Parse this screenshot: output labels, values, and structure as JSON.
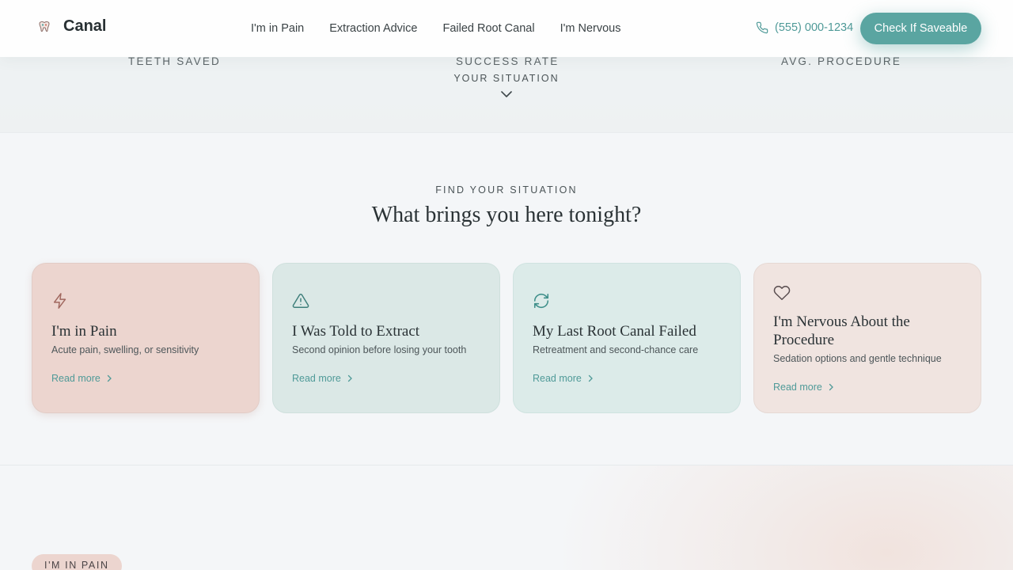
{
  "brand": {
    "name": "Canal"
  },
  "nav": {
    "links": [
      "I'm in Pain",
      "Extraction Advice",
      "Failed Root Canal",
      "I'm Nervous"
    ],
    "phone": "(555) 000-1234",
    "cta": "Check If Saveable"
  },
  "stats": {
    "labels": [
      "TEETH SAVED",
      "SUCCESS RATE",
      "AVG. PROCEDURE"
    ]
  },
  "scroll_hint": "YOUR SITUATION",
  "situations": {
    "eyebrow": "FIND YOUR SITUATION",
    "title": "What brings you here tonight?",
    "cards": [
      {
        "icon": "lightning-icon",
        "title": "I'm in Pain",
        "desc": "Acute pain, swelling, or sensitivity",
        "link": "Read more",
        "color": "#ecd5cf"
      },
      {
        "icon": "warning-icon",
        "title": "I Was Told to Extract",
        "desc": "Second opinion before losing your tooth",
        "link": "Read more",
        "color": "#dbe8e6"
      },
      {
        "icon": "refresh-icon",
        "title": "My Last Root Canal Failed",
        "desc": "Retreatment and second-chance care",
        "link": "Read more",
        "color": "#dcebe9"
      },
      {
        "icon": "heart-icon",
        "title": "I'm Nervous About the Procedure",
        "desc": "Sedation options and gentle technique",
        "link": "Read more",
        "color": "#f0e4e0"
      }
    ]
  },
  "next_section": {
    "pill": "I'M IN PAIN"
  },
  "colors": {
    "accent": "#5aa5a1",
    "accent_text": "#4f9a98",
    "text": "#2a3235"
  }
}
